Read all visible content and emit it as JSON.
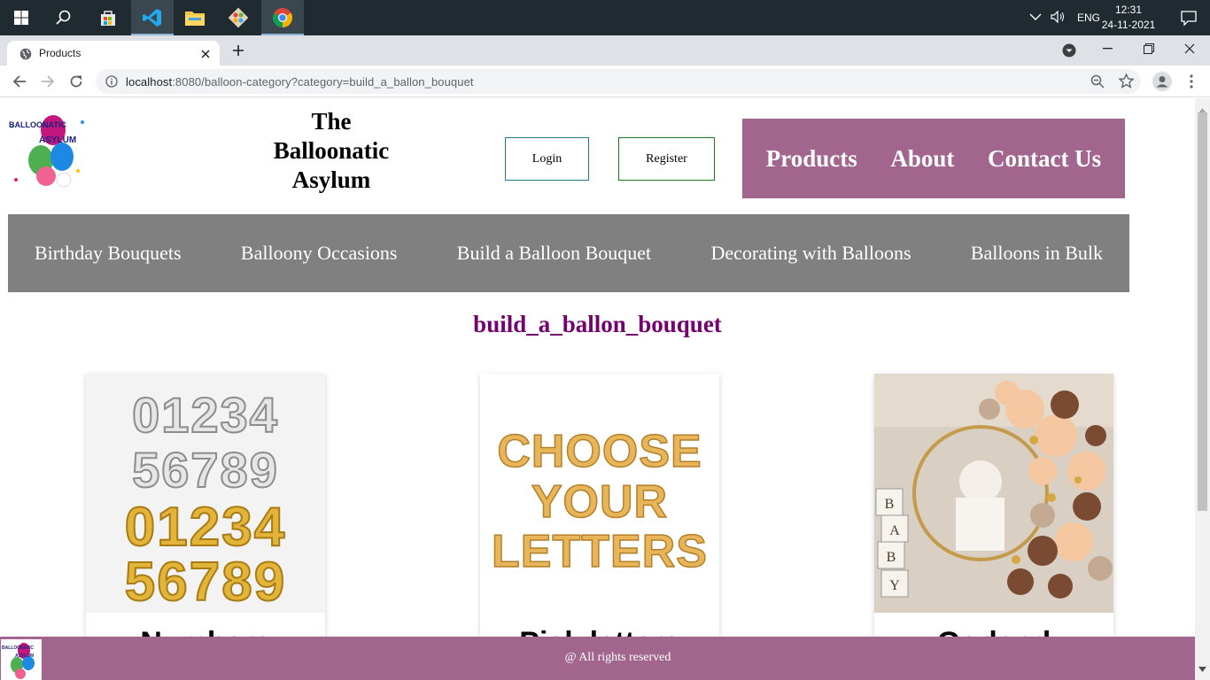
{
  "taskbar": {
    "apps": [
      "start-icon",
      "search-icon",
      "store-icon",
      "vscode-icon",
      "file-explorer-icon",
      "git-icon",
      "chrome-icon"
    ],
    "language": "ENG",
    "time": "12:31",
    "date": "24-11-2021"
  },
  "browser": {
    "tab_title": "Products",
    "url_host": "localhost",
    "url_rest": ":8080/balloon-category?category=build_a_ballon_bouquet"
  },
  "header": {
    "title_line1": "The",
    "title_line2": "Balloonatic",
    "title_line3": "Asylum",
    "login_label": "Login",
    "register_label": "Register",
    "nav": [
      "Products",
      "About",
      "Contact Us"
    ]
  },
  "categories": [
    "Birthday Bouquets",
    "Balloony Occasions",
    "Build a Balloon Bouquet",
    "Decorating with Balloons",
    "Balloons in Bulk"
  ],
  "page": {
    "heading": "build_a_ballon_bouquet"
  },
  "products": [
    {
      "title": "Numbers"
    },
    {
      "title": "Pick letters"
    },
    {
      "title": "Garland"
    }
  ],
  "footer": {
    "text": "@ All rights reserved"
  },
  "colors": {
    "accent": "#a2668e",
    "category_bar": "#808080",
    "heading": "#73006e"
  }
}
